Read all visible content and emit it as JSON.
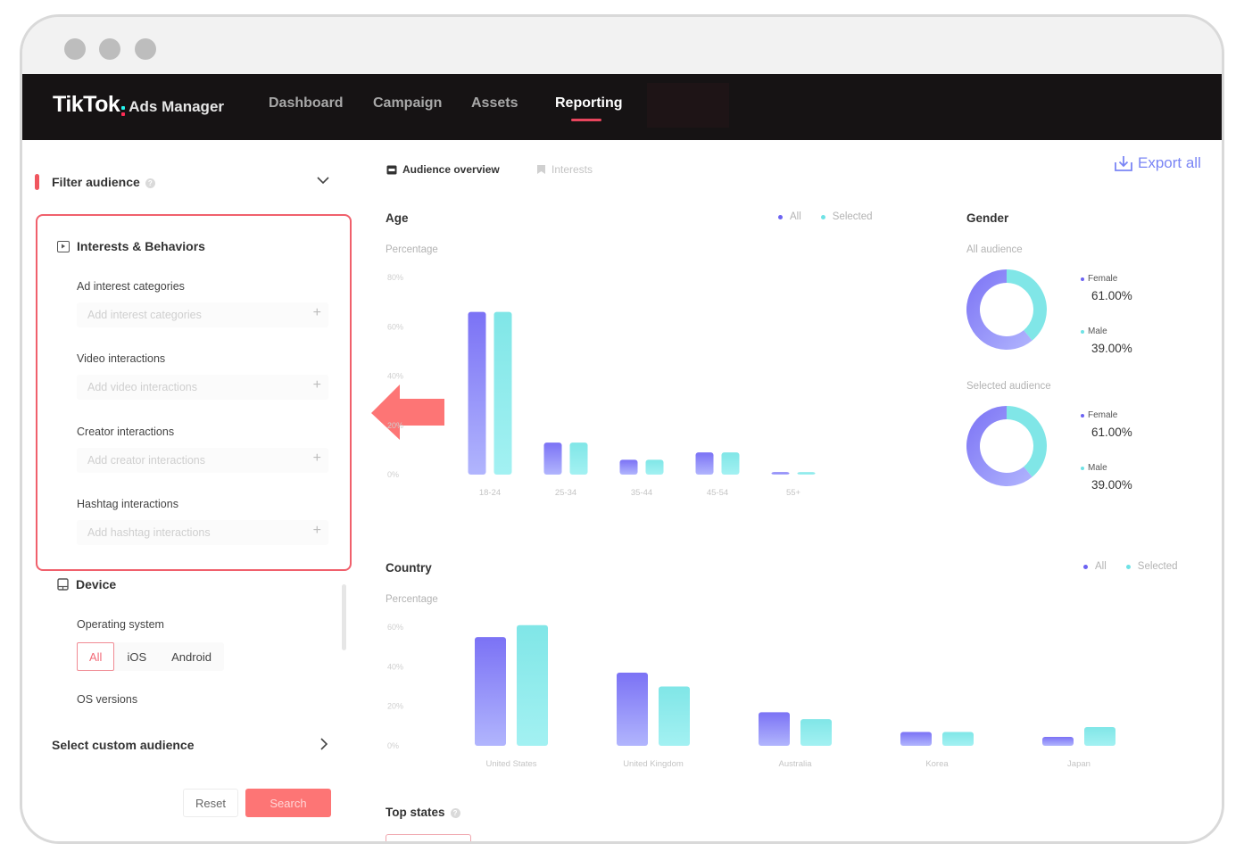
{
  "window": {
    "controls": [
      "close",
      "minimize",
      "maximize"
    ]
  },
  "nav": {
    "logo_brand": "TikTok",
    "logo_sub": "Ads Manager",
    "items": [
      {
        "label": "Dashboard",
        "active": false
      },
      {
        "label": "Campaign",
        "active": false
      },
      {
        "label": "Assets",
        "active": false
      },
      {
        "label": "Reporting",
        "active": true
      }
    ],
    "accent": "#e8455d"
  },
  "sidebar": {
    "filter_title": "Filter audience",
    "interests_section": {
      "title": "Interests & Behaviors",
      "fields": [
        {
          "label": "Ad interest categories",
          "placeholder": "Add interest categories"
        },
        {
          "label": "Video interactions",
          "placeholder": "Add video interactions"
        },
        {
          "label": "Creator interactions",
          "placeholder": "Add creator interactions"
        },
        {
          "label": "Hashtag interactions",
          "placeholder": "Add hashtag interactions"
        }
      ]
    },
    "device_section": {
      "title": "Device",
      "os_label": "Operating system",
      "os_options": [
        "All",
        "iOS",
        "Android"
      ],
      "os_selected": "All",
      "os_versions_label": "OS versions"
    },
    "custom_audience_label": "Select custom audience",
    "reset_label": "Reset",
    "search_label": "Search"
  },
  "main": {
    "tabs": [
      {
        "label": "Audience overview",
        "active": true
      },
      {
        "label": "Interests",
        "active": false
      }
    ],
    "export_label": "Export all",
    "legend": {
      "all": "All",
      "selected": "Selected"
    },
    "colors": {
      "all": "#7b72f5",
      "all_light": "#b1b5fd",
      "selected": "#80e6e7",
      "selected_light": "#a3f1f2",
      "export": "#7a85f5"
    },
    "age": {
      "title": "Age",
      "ylabel": "Percentage"
    },
    "country": {
      "title": "Country",
      "ylabel": "Percentage"
    },
    "gender": {
      "title": "Gender",
      "groups": [
        {
          "subtitle": "All audience",
          "female_label": "Female",
          "female_value": "61.00%",
          "male_label": "Male",
          "male_value": "39.00%"
        },
        {
          "subtitle": "Selected audience",
          "female_label": "Female",
          "female_value": "61.00%",
          "male_label": "Male",
          "male_value": "39.00%"
        }
      ]
    },
    "top_states": {
      "title": "Top states"
    }
  },
  "chart_data": [
    {
      "type": "bar",
      "title": "Age",
      "ylabel": "Percentage",
      "xlabel": "",
      "categories": [
        "18-24",
        "25-34",
        "35-44",
        "45-54",
        "55+"
      ],
      "series": [
        {
          "name": "All",
          "values": [
            66,
            13,
            6,
            9,
            1
          ]
        },
        {
          "name": "Selected",
          "values": [
            66,
            13,
            6,
            9,
            1
          ]
        }
      ],
      "yticks": [
        "0%",
        "20%",
        "40%",
        "60%",
        "80%"
      ],
      "ylim": [
        0,
        80
      ],
      "legend": "top-right",
      "grid": false
    },
    {
      "type": "bar",
      "title": "Country",
      "ylabel": "Percentage",
      "xlabel": "",
      "categories": [
        "United States",
        "United Kingdom",
        "Australia",
        "Korea",
        "Japan"
      ],
      "series": [
        {
          "name": "All",
          "values": [
            55,
            37,
            17,
            7,
            4.5
          ]
        },
        {
          "name": "Selected",
          "values": [
            61,
            30,
            13.5,
            7,
            9.5
          ]
        }
      ],
      "yticks": [
        "0%",
        "20%",
        "40%",
        "60%"
      ],
      "ylim": [
        0,
        60
      ],
      "legend": "top-right",
      "grid": false
    },
    {
      "type": "pie",
      "title": "Gender - All audience",
      "categories": [
        "Female",
        "Male"
      ],
      "values": [
        61,
        39
      ]
    },
    {
      "type": "pie",
      "title": "Gender - Selected audience",
      "categories": [
        "Female",
        "Male"
      ],
      "values": [
        61,
        39
      ]
    }
  ]
}
